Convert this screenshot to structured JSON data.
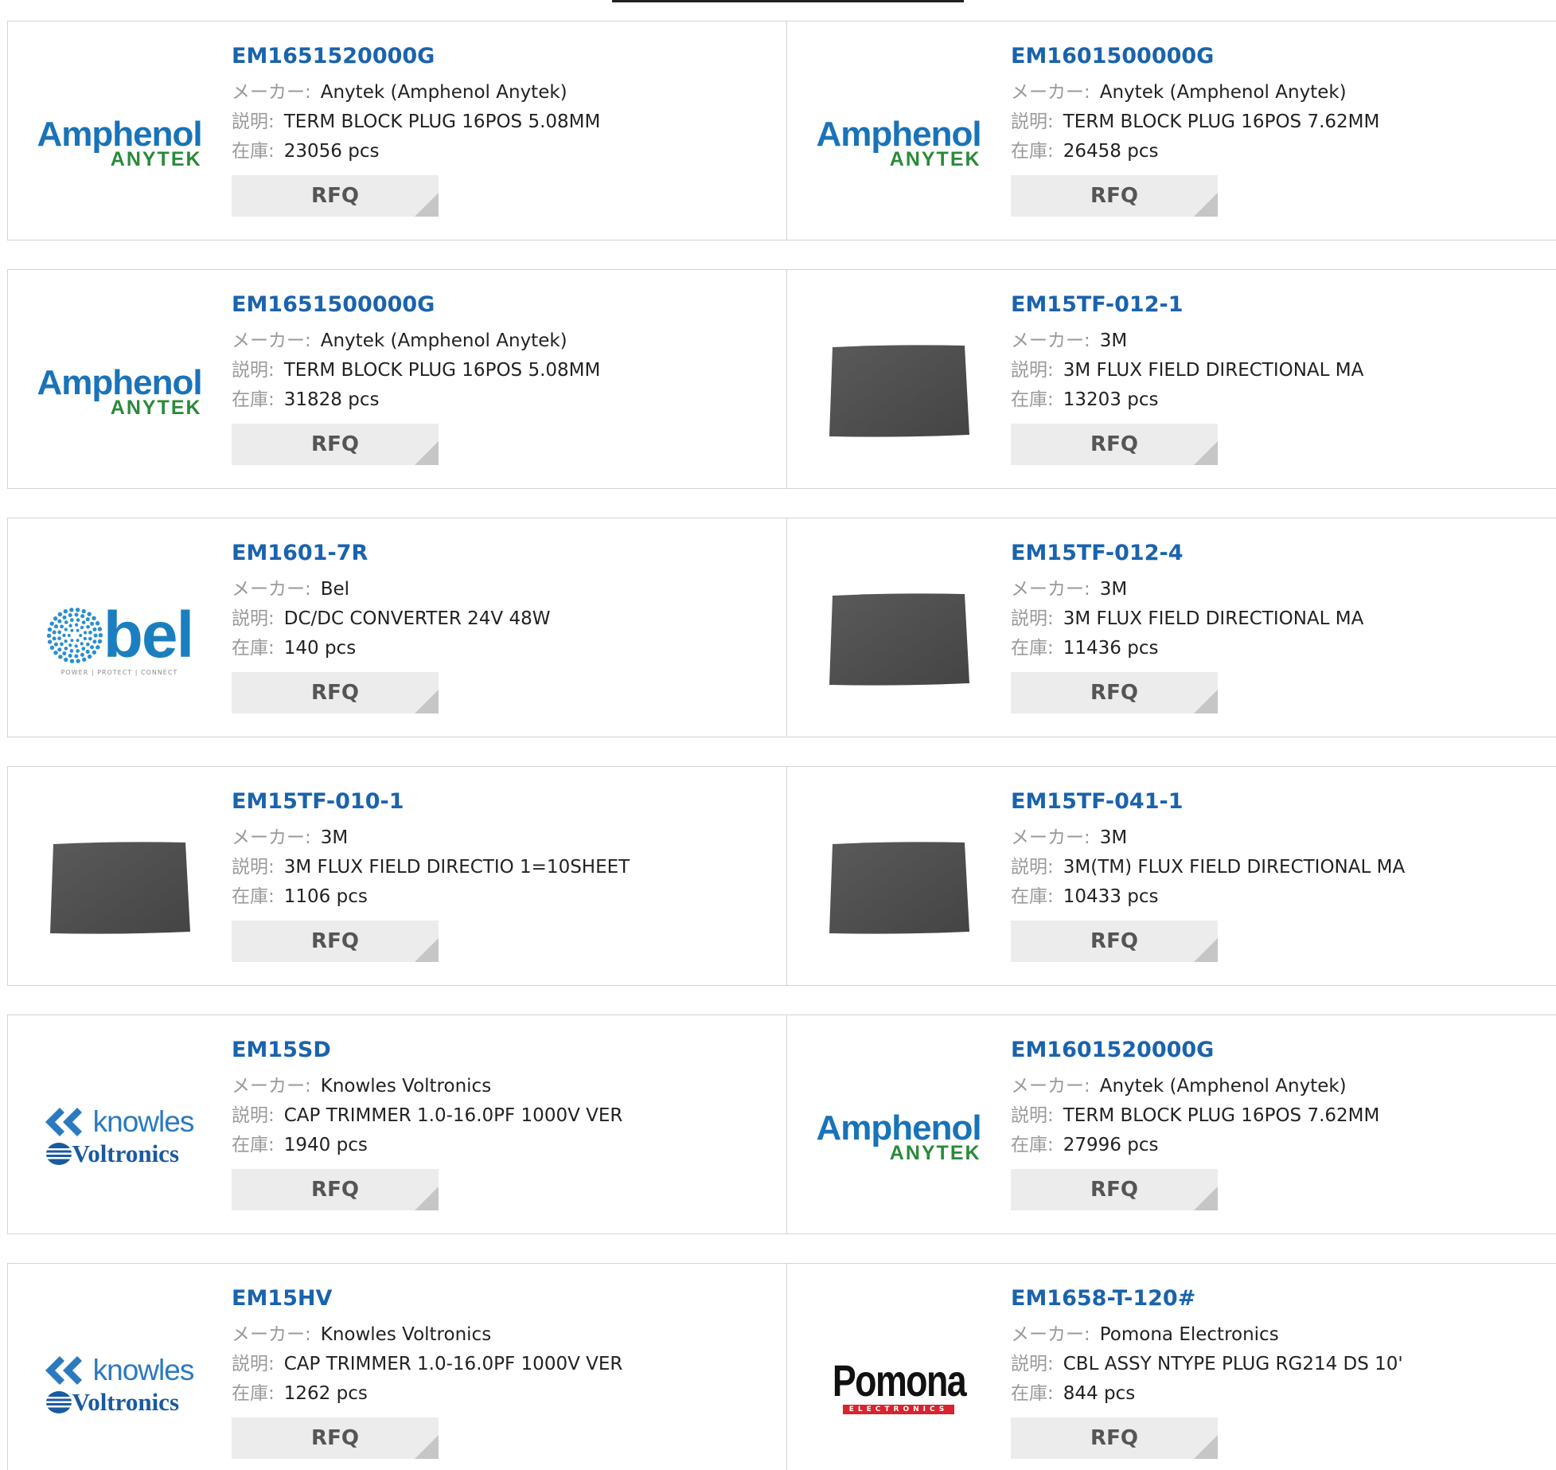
{
  "labels": {
    "maker": "メーカー:",
    "description": "説明:",
    "stock": "在庫:"
  },
  "rfq_label": "RFQ",
  "products": [
    {
      "part": "EM1651520000G",
      "maker": "Anytek (Amphenol Anytek)",
      "description": "TERM BLOCK PLUG 16POS 5.08MM",
      "stock": "23056 pcs",
      "logo": "amphenol-anytek-logo"
    },
    {
      "part": "EM1601500000G",
      "maker": "Anytek (Amphenol Anytek)",
      "description": "TERM BLOCK PLUG 16POS 7.62MM",
      "stock": "26458 pcs",
      "logo": "amphenol-anytek-logo"
    },
    {
      "part": "EM1651500000G",
      "maker": "Anytek (Amphenol Anytek)",
      "description": "TERM BLOCK PLUG 16POS 5.08MM",
      "stock": "31828 pcs",
      "logo": "amphenol-anytek-logo"
    },
    {
      "part": "EM15TF-012-1",
      "maker": "3M",
      "description": "3M FLUX FIELD DIRECTIONAL MA",
      "stock": "13203 pcs",
      "logo": "flux-sheet-photo"
    },
    {
      "part": "EM1601-7R",
      "maker": "Bel",
      "description": "DC/DC CONVERTER 24V 48W",
      "stock": "140 pcs",
      "logo": "bel-logo"
    },
    {
      "part": "EM15TF-012-4",
      "maker": "3M",
      "description": "3M FLUX FIELD DIRECTIONAL MA",
      "stock": "11436 pcs",
      "logo": "flux-sheet-photo"
    },
    {
      "part": "EM15TF-010-1",
      "maker": "3M",
      "description": "3M FLUX FIELD DIRECTIO 1=10SHEET",
      "stock": "1106 pcs",
      "logo": "flux-sheet-photo"
    },
    {
      "part": "EM15TF-041-1",
      "maker": "3M",
      "description": "3M(TM) FLUX FIELD DIRECTIONAL MA",
      "stock": "10433 pcs",
      "logo": "flux-sheet-photo"
    },
    {
      "part": "EM15SD",
      "maker": "Knowles Voltronics",
      "description": "CAP TRIMMER 1.0-16.0PF 1000V VER",
      "stock": "1940 pcs",
      "logo": "knowles-voltronics-logo"
    },
    {
      "part": "EM1601520000G",
      "maker": "Anytek (Amphenol Anytek)",
      "description": "TERM BLOCK PLUG 16POS 7.62MM",
      "stock": "27996 pcs",
      "logo": "amphenol-anytek-logo"
    },
    {
      "part": "EM15HV",
      "maker": "Knowles Voltronics",
      "description": "CAP TRIMMER 1.0-16.0PF 1000V VER",
      "stock": "1262 pcs",
      "logo": "knowles-voltronics-logo"
    },
    {
      "part": "EM1658-T-120#",
      "maker": "Pomona Electronics",
      "description": "CBL ASSY NTYPE PLUG RG214 DS 10'",
      "stock": "844 pcs",
      "logo": "pomona-logo"
    }
  ],
  "logo_text": {
    "amphenol": [
      "Amphenol",
      "ANYTEK"
    ],
    "bel": [
      "bel",
      "POWER | PROTECT | CONNECT"
    ],
    "knowles": [
      "knowles",
      "Voltronics"
    ],
    "pomona": [
      "Pomona",
      "ELECTRONICS"
    ]
  },
  "colors": {
    "part_link": "#1a63ad",
    "label_gray": "#9a9a9a",
    "rfq_bg": "#ececec",
    "border": "#d4d4d4"
  }
}
